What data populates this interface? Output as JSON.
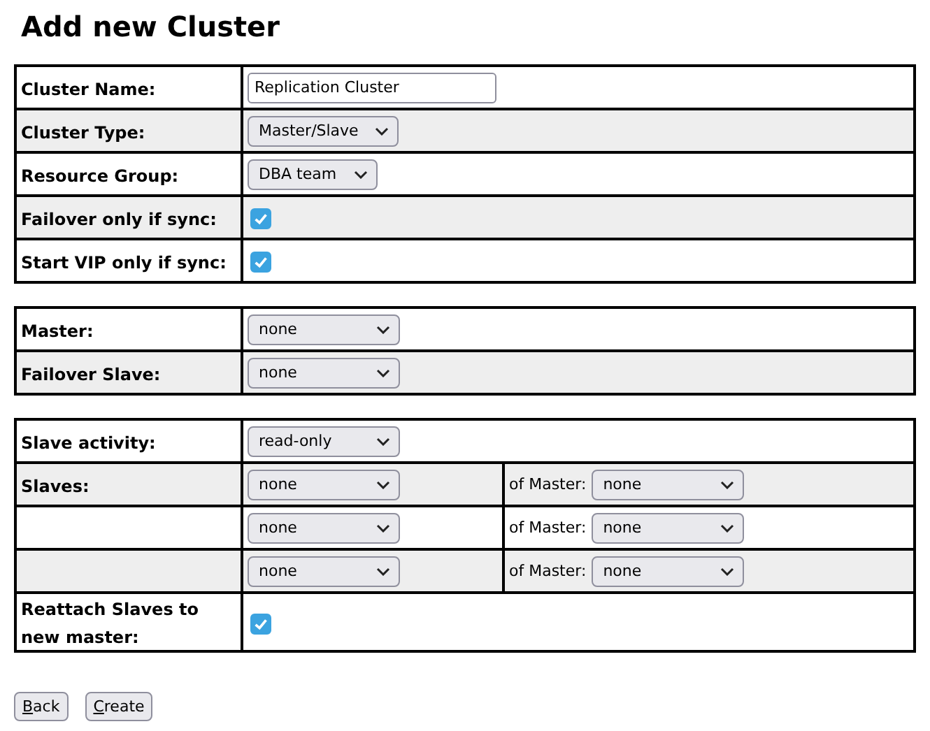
{
  "title": "Add new Cluster",
  "sections": [
    {
      "rows": [
        {
          "kind": "text",
          "label": "Cluster Name:",
          "value": "Replication Cluster"
        },
        {
          "kind": "select",
          "label": "Cluster Type:",
          "value": "Master/Slave"
        },
        {
          "kind": "select",
          "label": "Resource Group:",
          "value": "DBA team"
        },
        {
          "kind": "checkbox",
          "label": "Failover only if sync:",
          "checked": true
        },
        {
          "kind": "checkbox",
          "label": "Start VIP only if sync:",
          "checked": true
        }
      ]
    },
    {
      "rows": [
        {
          "kind": "select",
          "label": "Master:",
          "value": "none"
        },
        {
          "kind": "select",
          "label": "Failover Slave:",
          "value": "none"
        }
      ]
    },
    {
      "rows": [
        {
          "kind": "select",
          "label": "Slave activity:",
          "value": "read-only"
        },
        {
          "kind": "pair",
          "label": "Slaves:",
          "value": "none",
          "master_label": "of Master:",
          "master": "none"
        },
        {
          "kind": "pair",
          "value": "none",
          "master_label": "of Master:",
          "master": "none"
        },
        {
          "kind": "pair",
          "value": "none",
          "master_label": "of Master:",
          "master": "none"
        },
        {
          "kind": "checkbox",
          "label": "Reattach Slaves to new master:",
          "checked": true
        }
      ]
    }
  ],
  "buttons": [
    {
      "label": "Back",
      "mnemonic": true
    },
    {
      "label": "Create",
      "mnemonic": true
    }
  ]
}
